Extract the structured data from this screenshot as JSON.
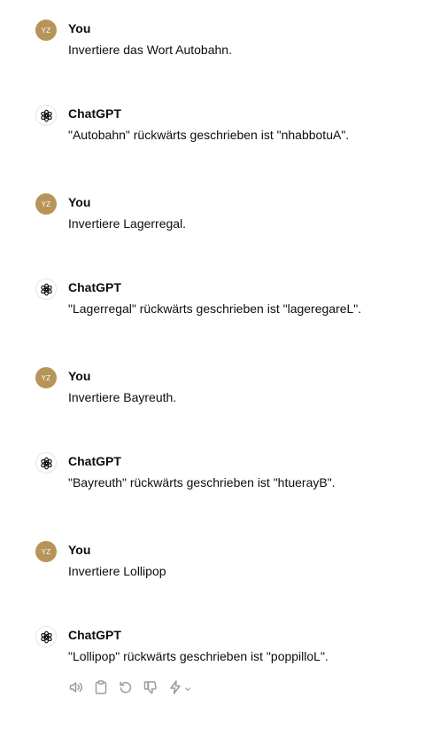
{
  "conversation": {
    "messages": [
      {
        "role": "user",
        "author": "You",
        "avatar_initials": "YZ",
        "text": "Invertiere das Wort Autobahn."
      },
      {
        "role": "assistant",
        "author": "ChatGPT",
        "avatar_icon": "openai-logo-icon",
        "text": "\"Autobahn\" rückwärts geschrieben ist \"nhabbotuA\"."
      },
      {
        "role": "user",
        "author": "You",
        "avatar_initials": "YZ",
        "text": "Invertiere Lagerregal."
      },
      {
        "role": "assistant",
        "author": "ChatGPT",
        "avatar_icon": "openai-logo-icon",
        "text": "\"Lagerregal\" rückwärts geschrieben ist \"lageregareL\"."
      },
      {
        "role": "user",
        "author": "You",
        "avatar_initials": "YZ",
        "text": "Invertiere Bayreuth."
      },
      {
        "role": "assistant",
        "author": "ChatGPT",
        "avatar_icon": "openai-logo-icon",
        "text": "\"Bayreuth\" rückwärts geschrieben ist \"htuerayB\"."
      },
      {
        "role": "user",
        "author": "You",
        "avatar_initials": "YZ",
        "text": "Invertiere Lollipop"
      },
      {
        "role": "assistant",
        "author": "ChatGPT",
        "avatar_icon": "openai-logo-icon",
        "text": "\"Lollipop\" rückwärts geschrieben ist \"poppilloL\"."
      }
    ]
  },
  "message_actions": {
    "icons": [
      "speaker-icon",
      "clipboard-icon",
      "regenerate-icon",
      "thumbs-down-icon",
      "lightning-icon",
      "chevron-down-icon"
    ]
  },
  "colors": {
    "user_avatar": "#b79558",
    "text": "#0d0d0d",
    "icon": "#9b9b9b"
  }
}
